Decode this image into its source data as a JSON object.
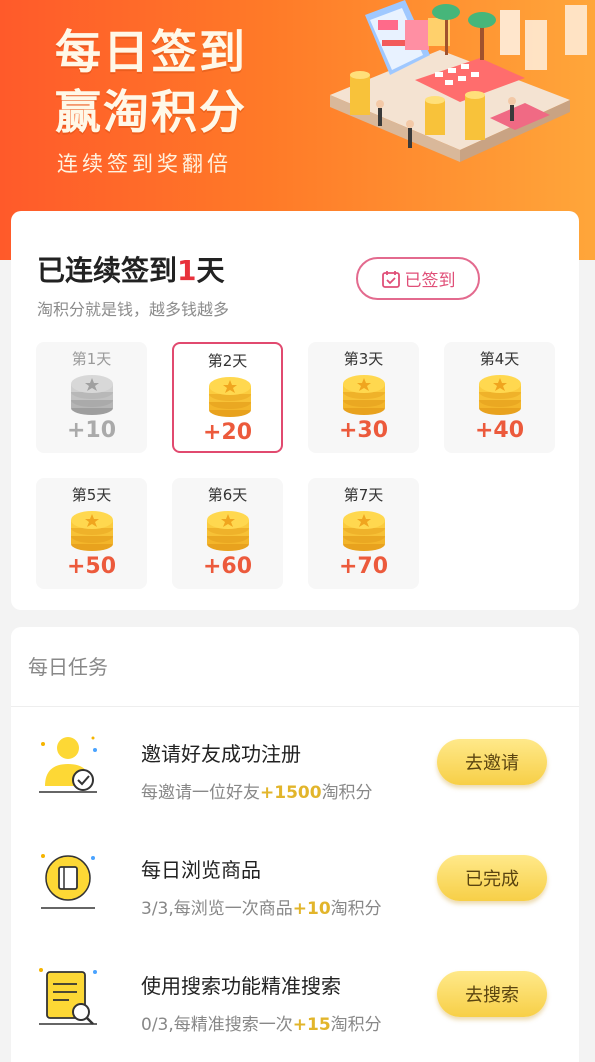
{
  "hero": {
    "title_line1": "每日签到",
    "title_line2": "赢淘积分",
    "subtitle": "连续签到奖翻倍"
  },
  "signin": {
    "streak_prefix": "已连续签到",
    "streak_days": "1",
    "streak_suffix": "天",
    "subtitle": "淘积分就是钱，越多钱越多",
    "signed_label": "已签到",
    "days": [
      {
        "label": "第1天",
        "points": "+10",
        "state": "done"
      },
      {
        "label": "第2天",
        "points": "+20",
        "state": "active"
      },
      {
        "label": "第3天",
        "points": "+30",
        "state": "pending"
      },
      {
        "label": "第4天",
        "points": "+40",
        "state": "pending"
      },
      {
        "label": "第5天",
        "points": "+50",
        "state": "pending"
      },
      {
        "label": "第6天",
        "points": "+60",
        "state": "pending"
      },
      {
        "label": "第7天",
        "points": "+70",
        "state": "pending"
      }
    ]
  },
  "tasks": {
    "heading": "每日任务",
    "items": [
      {
        "icon": "user-check-icon",
        "title": "邀请好友成功注册",
        "desc_prefix": "每邀请一位好友",
        "desc_highlight": "+1500",
        "desc_suffix": "淘积分",
        "button": "去邀请"
      },
      {
        "icon": "browse-goods-icon",
        "title": "每日浏览商品",
        "desc_prefix": "3/3,每浏览一次商品",
        "desc_highlight": "+10",
        "desc_suffix": "淘积分",
        "button": "已完成"
      },
      {
        "icon": "search-doc-icon",
        "title": "使用搜索功能精准搜索",
        "desc_prefix": "0/3,每精准搜索一次",
        "desc_highlight": "+15",
        "desc_suffix": "淘积分",
        "button": "去搜索"
      }
    ]
  },
  "colors": {
    "accent_red": "#e8323c",
    "points_orange": "#ec5a3c",
    "highlight_gold": "#e2b52b",
    "button_yellow": "#f7cf47"
  }
}
